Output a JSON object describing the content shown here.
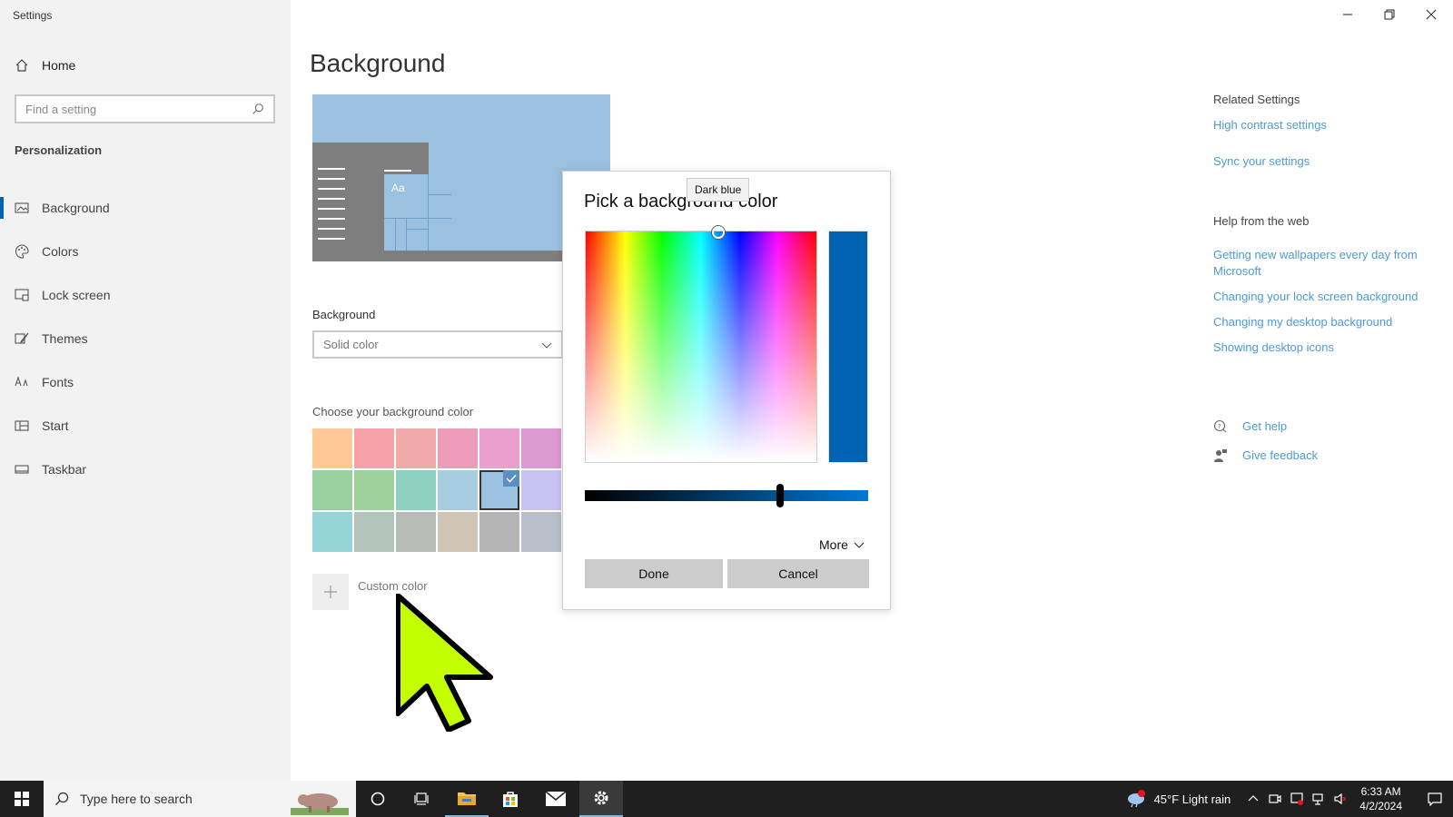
{
  "window": {
    "app_title": "Settings",
    "controls": [
      "minimize",
      "restore",
      "close"
    ]
  },
  "sidebar": {
    "home_label": "Home",
    "search_placeholder": "Find a setting",
    "section_label": "Personalization",
    "items": [
      {
        "label": "Background",
        "icon": "picture-icon",
        "active": true
      },
      {
        "label": "Colors",
        "icon": "palette-icon",
        "active": false
      },
      {
        "label": "Lock screen",
        "icon": "lock-screen-icon",
        "active": false
      },
      {
        "label": "Themes",
        "icon": "brush-icon",
        "active": false
      },
      {
        "label": "Fonts",
        "icon": "font-icon",
        "active": false
      },
      {
        "label": "Start",
        "icon": "start-icon",
        "active": false
      },
      {
        "label": "Taskbar",
        "icon": "taskbar-icon",
        "active": false
      }
    ]
  },
  "main": {
    "title": "Background",
    "preview": {
      "aa_text": "Aa",
      "bg_color": "#9cc0e0"
    },
    "background_label": "Background",
    "background_value": "Solid color",
    "choose_label": "Choose your background color",
    "swatches": [
      "#ffc895",
      "#f7a1a8",
      "#f2a9aa",
      "#ec9bbb",
      "#ea9fcf",
      "#dc9ad2",
      "#99d0a0",
      "#9fd19d",
      "#8fd0c0",
      "#a6cde0",
      "#9cc0e0",
      "#c9c3f5",
      "#96d5d7",
      "#b3c4bd",
      "#b7bcb7",
      "#d0c5b6",
      "#b5b5b5",
      "#b9bfca"
    ],
    "selected_swatch_index": 10,
    "custom_color_label": "Custom color"
  },
  "related": {
    "heading": "Related Settings",
    "links": [
      "High contrast settings",
      "Sync your settings"
    ],
    "web_heading": "Help from the web",
    "web_links": [
      "Getting new wallpapers every day from Microsoft",
      "Changing your lock screen background",
      "Changing my desktop background",
      "Showing desktop icons"
    ],
    "help": {
      "get_help": "Get help",
      "give_feedback": "Give feedback"
    }
  },
  "dialog": {
    "title": "Pick a background color",
    "tooltip": "Dark blue",
    "selected_color": "#0063b1",
    "more_label": "More",
    "done_label": "Done",
    "cancel_label": "Cancel"
  },
  "taskbar": {
    "search_placeholder": "Type here to search",
    "weather": "45°F  Light rain",
    "time": "6:33 AM",
    "date": "4/2/2024",
    "accent": "#76b9ed"
  },
  "colors": {
    "link": "#4d9ad6",
    "accent": "#0063b1",
    "cursor": "#c3ff00"
  }
}
